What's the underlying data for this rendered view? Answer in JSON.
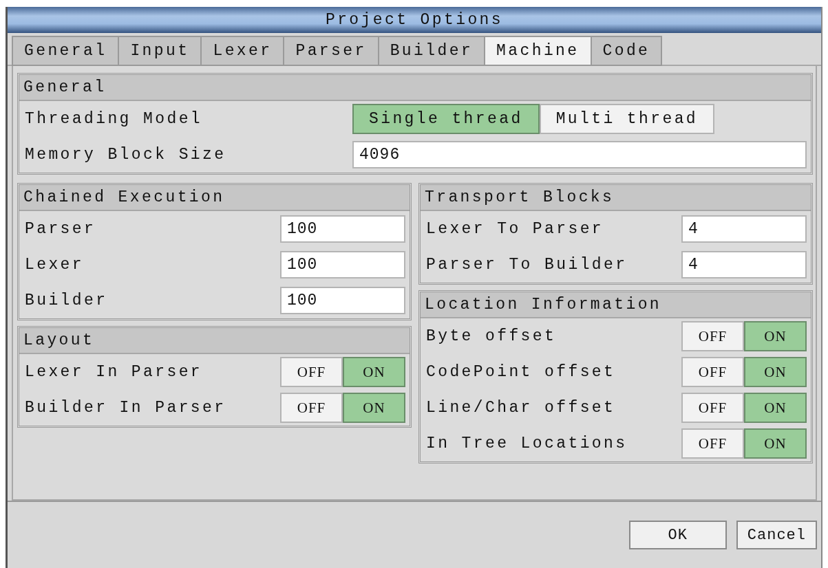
{
  "window": {
    "title": "Project Options"
  },
  "tabs": [
    {
      "label": "General",
      "selected": false
    },
    {
      "label": "Input",
      "selected": false
    },
    {
      "label": "Lexer",
      "selected": false
    },
    {
      "label": "Parser",
      "selected": false
    },
    {
      "label": "Builder",
      "selected": false
    },
    {
      "label": "Machine",
      "selected": true
    },
    {
      "label": "Code",
      "selected": false
    }
  ],
  "general": {
    "title": "General",
    "rows": [
      {
        "kind": "choice",
        "label": "Threading Model",
        "options": [
          {
            "label": "Single thread",
            "selected": true
          },
          {
            "label": "Multi thread",
            "selected": false
          }
        ]
      },
      {
        "kind": "field",
        "label": "Memory Block Size",
        "value": "4096"
      }
    ]
  },
  "left_column": [
    {
      "title": "Chained Execution",
      "rows": [
        {
          "kind": "field",
          "label": "Parser",
          "value": "100"
        },
        {
          "kind": "field",
          "label": "Lexer",
          "value": "100"
        },
        {
          "kind": "field",
          "label": "Builder",
          "value": "100"
        }
      ]
    },
    {
      "title": "Layout",
      "rows": [
        {
          "kind": "toggle",
          "label": "Lexer In Parser",
          "options": [
            {
              "label": "OFF",
              "selected": false
            },
            {
              "label": "ON",
              "selected": true
            }
          ]
        },
        {
          "kind": "toggle",
          "label": "Builder In Parser",
          "options": [
            {
              "label": "OFF",
              "selected": false
            },
            {
              "label": "ON",
              "selected": true
            }
          ]
        }
      ]
    }
  ],
  "right_column": [
    {
      "title": "Transport Blocks",
      "rows": [
        {
          "kind": "field",
          "label": "Lexer To Parser",
          "value": "4"
        },
        {
          "kind": "field",
          "label": "Parser To Builder",
          "value": "4"
        }
      ]
    },
    {
      "title": "Location Information",
      "rows": [
        {
          "kind": "toggle",
          "label": "Byte offset",
          "options": [
            {
              "label": "OFF",
              "selected": false
            },
            {
              "label": "ON",
              "selected": true
            }
          ]
        },
        {
          "kind": "toggle",
          "label": "CodePoint offset",
          "options": [
            {
              "label": "OFF",
              "selected": false
            },
            {
              "label": "ON",
              "selected": true
            }
          ]
        },
        {
          "kind": "toggle",
          "label": "Line/Char offset",
          "options": [
            {
              "label": "OFF",
              "selected": false
            },
            {
              "label": "ON",
              "selected": true
            }
          ]
        },
        {
          "kind": "toggle",
          "label": "In Tree Locations",
          "options": [
            {
              "label": "OFF",
              "selected": false
            },
            {
              "label": "ON",
              "selected": true
            }
          ]
        }
      ]
    }
  ],
  "buttons": [
    "OK",
    "Cancel"
  ]
}
